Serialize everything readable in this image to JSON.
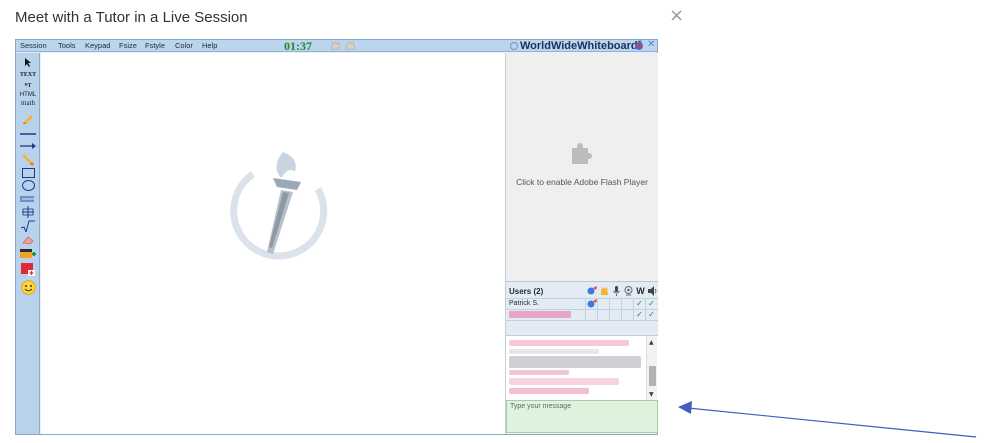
{
  "modal": {
    "title": "Meet with a Tutor in a Live Session",
    "close_glyph": "×"
  },
  "menubar": {
    "items": [
      "Session",
      "Tools",
      "Keypad",
      "Fsize",
      "Fstyle",
      "Color",
      "Help"
    ],
    "timer": "01:37",
    "brand": "WorldWideWhiteboard",
    "brand_mark": "®",
    "x_glyph": "✕"
  },
  "toolbar": {
    "text_tool": "TEXT",
    "latex_tool": "ᴷT",
    "html_tool": "HTML",
    "math_tool": "math"
  },
  "flash": {
    "message": "Click to enable Adobe Flash Player"
  },
  "users": {
    "header": "Users (2)",
    "col_w": "W",
    "rows": [
      {
        "name": "Patrick S.",
        "check1": "✓",
        "check2": "✓"
      },
      {
        "name": "",
        "check1": "✓",
        "check2": "✓"
      }
    ]
  },
  "chat": {
    "up_glyph": "▲",
    "down_glyph": "▼"
  },
  "message_box": {
    "placeholder": "Type your message"
  },
  "colors": {
    "toolbar_bg": "#b9d2ec",
    "menubar_bg": "#bcd5ee",
    "timer": "#218a2a",
    "message_bg": "#dff2dd",
    "annotation_arrow": "#3f5fbf"
  }
}
